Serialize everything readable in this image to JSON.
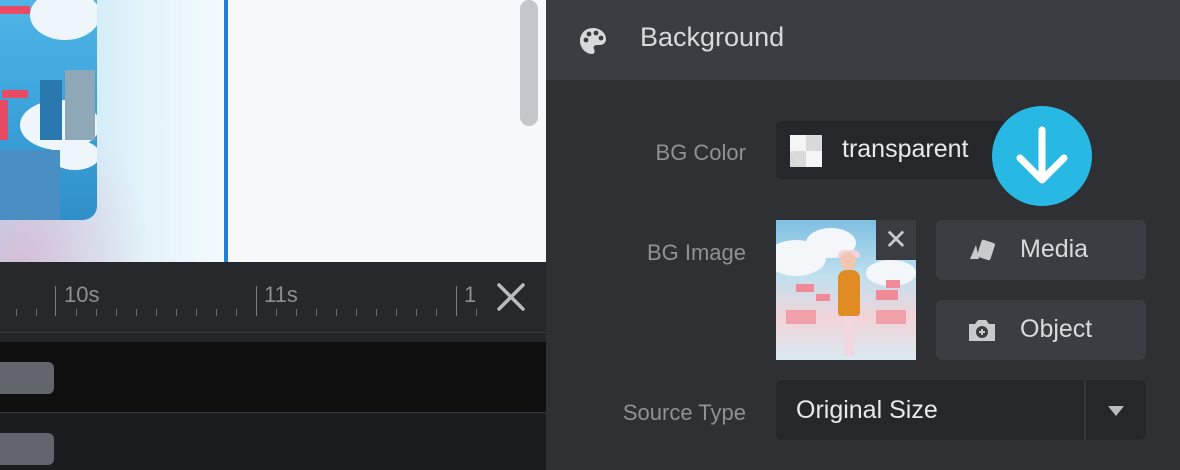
{
  "timeline": {
    "tick_labels": [
      "10s",
      "11s",
      "1"
    ],
    "close_icon": "close-icon"
  },
  "panel": {
    "section_title": "Background",
    "section_icon": "palette-icon",
    "bg_color": {
      "label": "BG Color",
      "value": "transparent",
      "download_icon": "arrow-down-icon"
    },
    "bg_image": {
      "label": "BG Image",
      "thumb_close_glyph": "✕",
      "media_label": "Media",
      "object_label": "Object",
      "media_icon": "media-icon",
      "object_icon": "camera-plus-icon"
    },
    "source_type": {
      "label": "Source Type",
      "value": "Original Size"
    }
  },
  "colors": {
    "accent": "#27b9e3",
    "playhead": "#1f7fd6",
    "panel_bg": "#2f3034",
    "header_bg": "#3b3d43"
  }
}
